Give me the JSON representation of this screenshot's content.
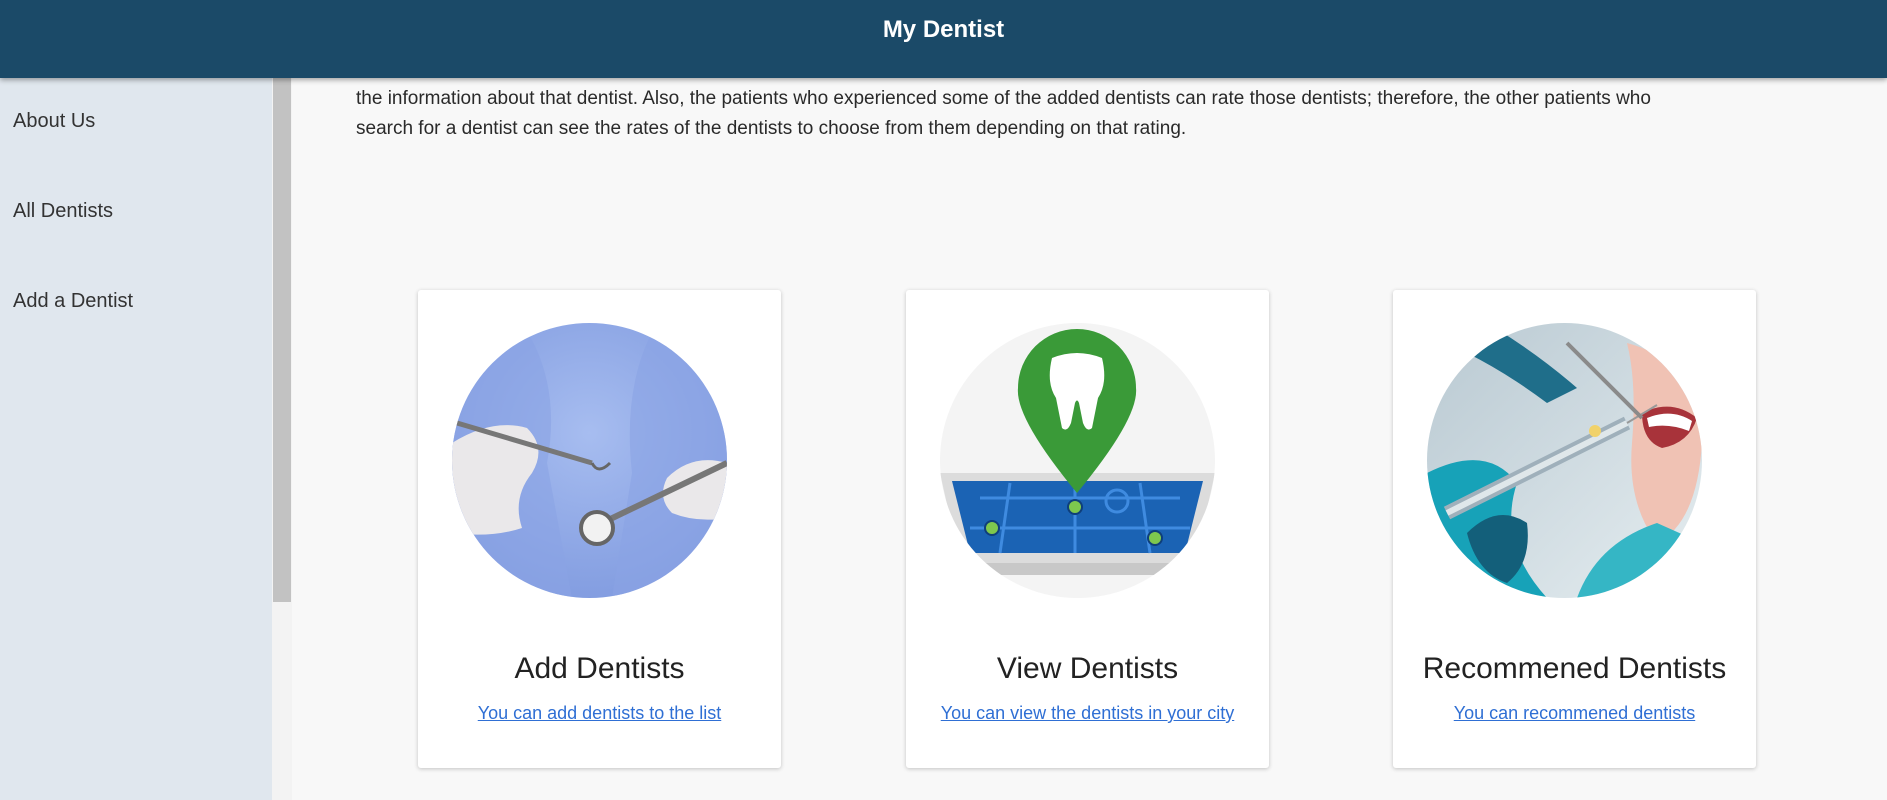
{
  "header": {
    "title": "My Dentist"
  },
  "sidebar": {
    "items": [
      {
        "label": "About Us"
      },
      {
        "label": "All Dentists"
      },
      {
        "label": "Add a Dentist"
      }
    ]
  },
  "intro": {
    "line1": "the information about that dentist. Also, the patients who experienced some of the added dentists can rate those dentists; therefore, the other patients who",
    "line2": "search for a dentist can see the rates of the dentists to choose from them depending on that rating."
  },
  "cards": [
    {
      "title": "Add Dentists",
      "link": "You can add dentists to the list",
      "icon": "dental-tools-photo"
    },
    {
      "title": "View Dentists",
      "link": "You can view the dentists in your city",
      "icon": "tooth-map-pin-icon"
    },
    {
      "title": "Recommened Dentists",
      "link": "You can recommened dentists",
      "icon": "dental-treatment-photo"
    }
  ],
  "colors": {
    "header": "#1b4a68",
    "sidebar": "#e0e7ee",
    "link": "#2f6fd4",
    "pin": "#3a9a38"
  }
}
